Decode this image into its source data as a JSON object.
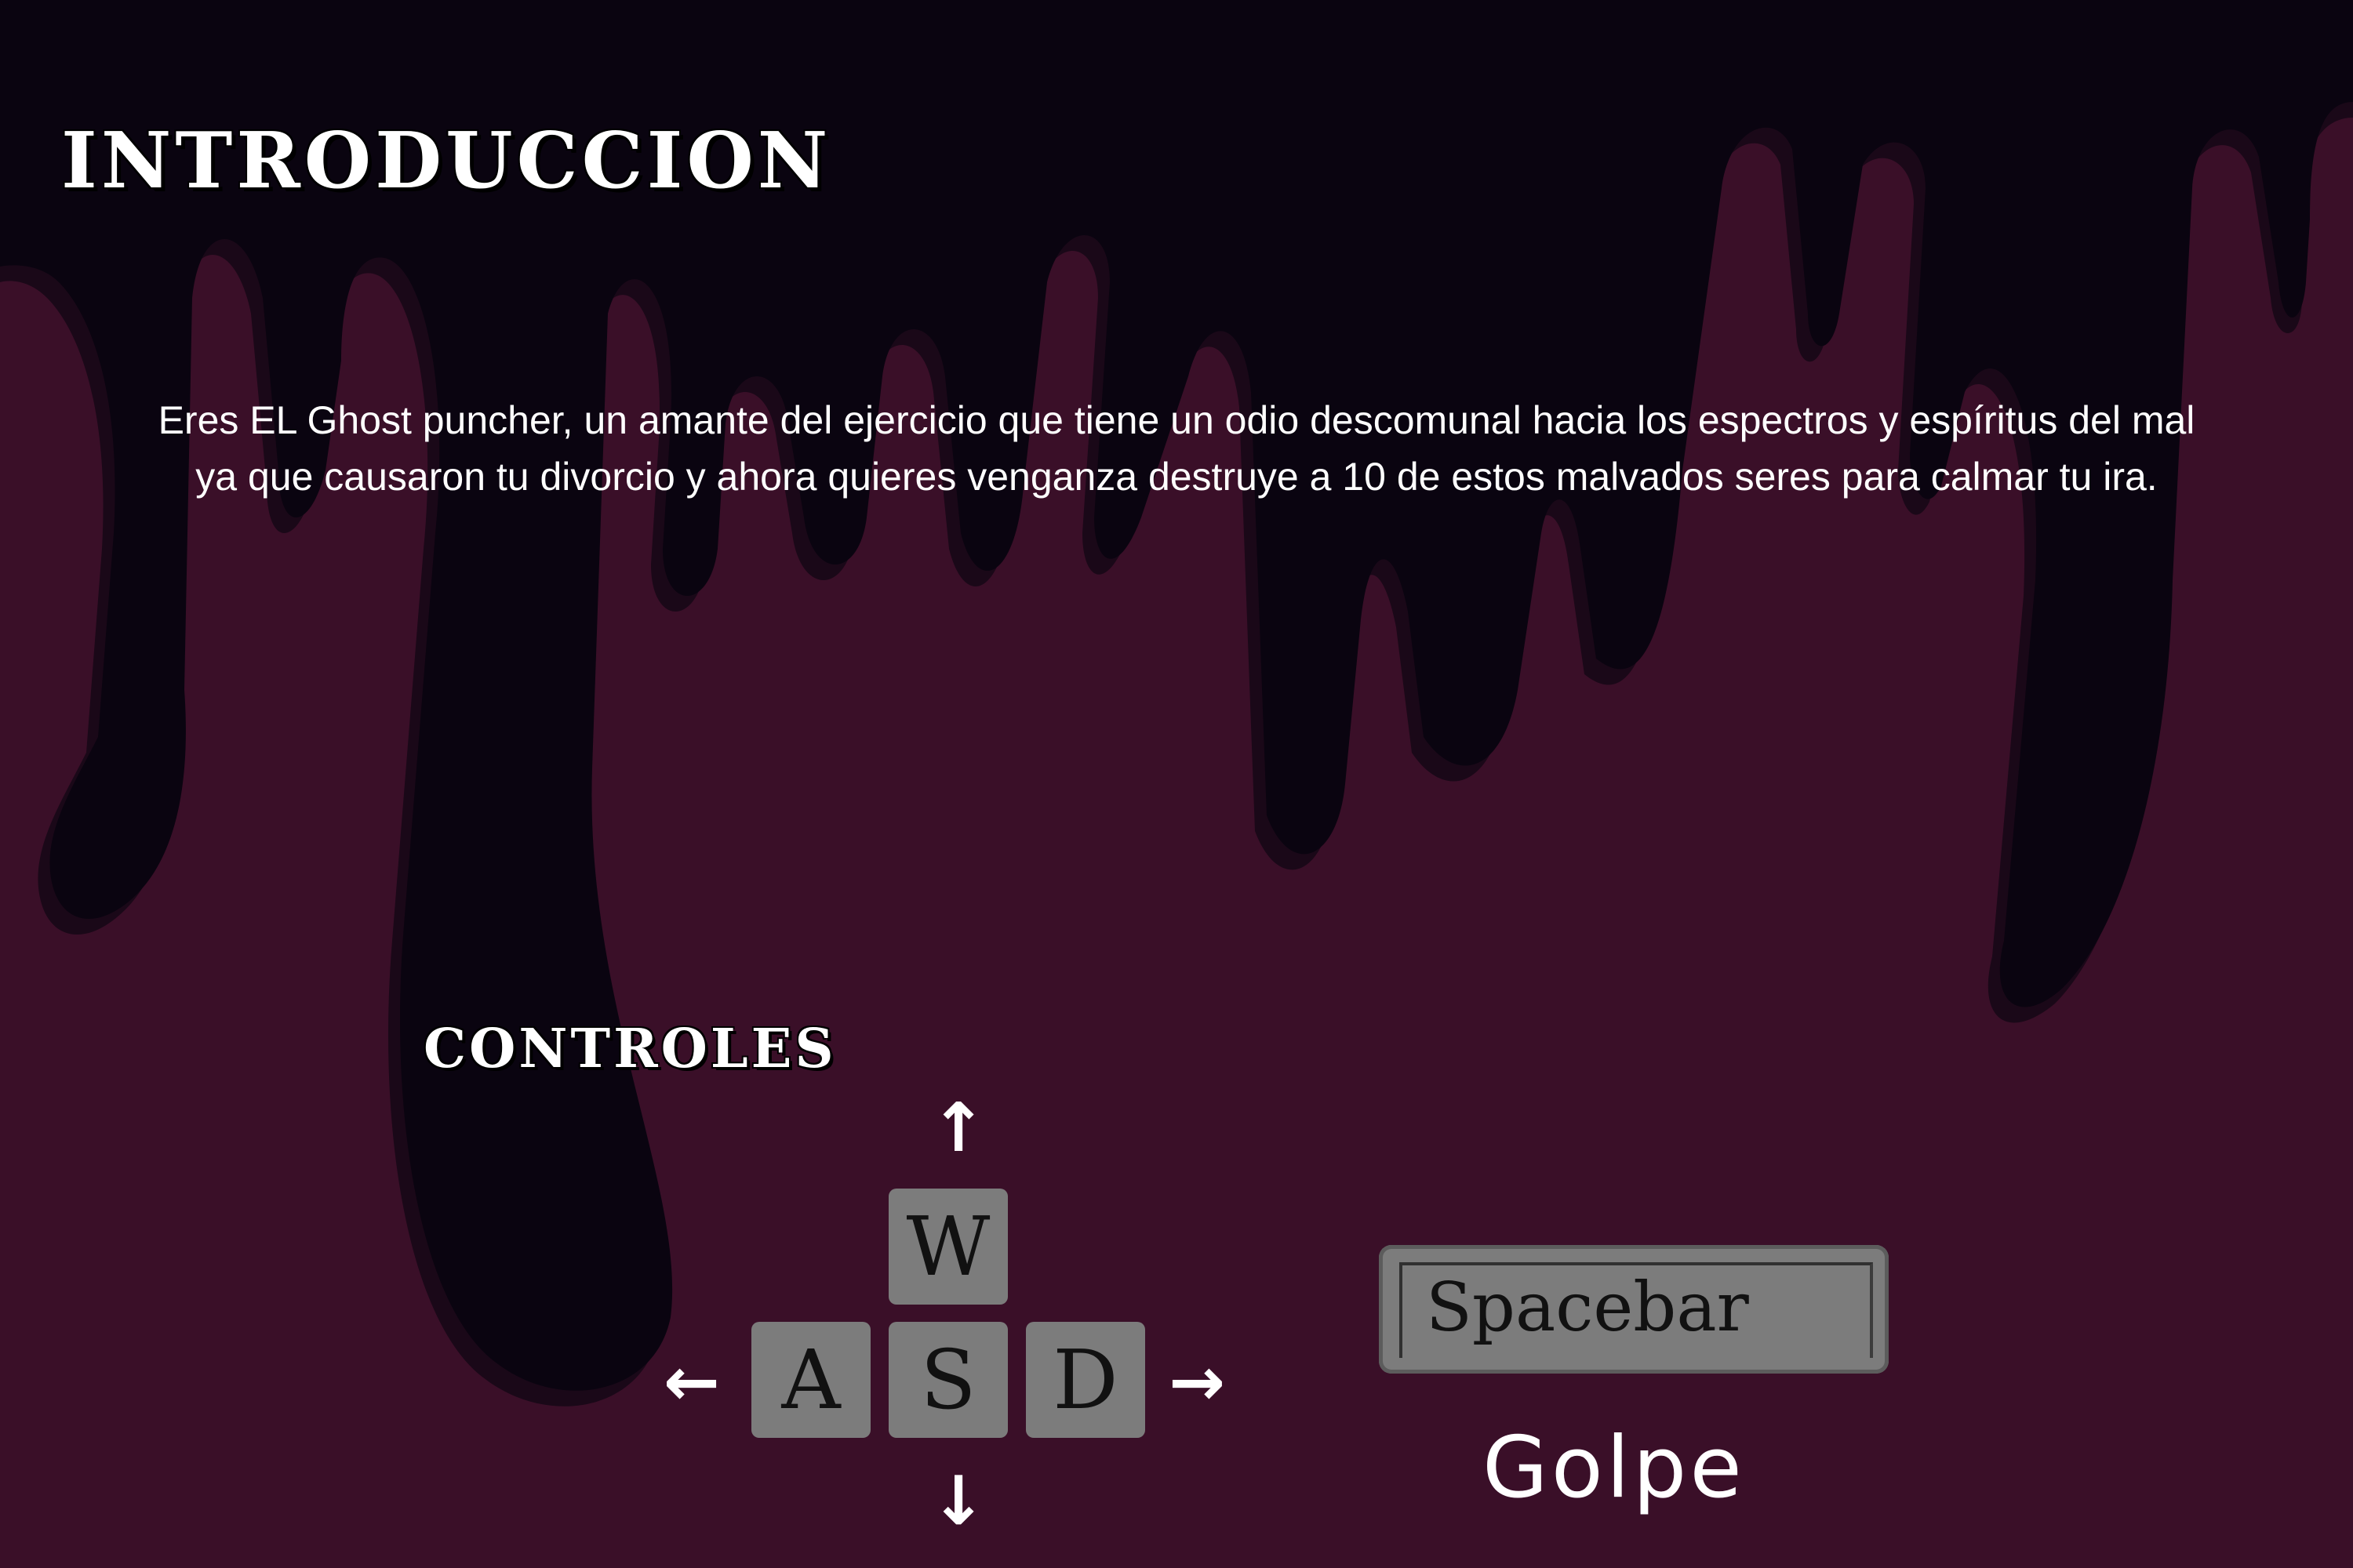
{
  "screen": {
    "title": "INTRODUCCION",
    "intro_lines": [
      "Eres EL Ghost puncher, un amante del ejercicio que tiene un odio descomunal hacia los espectros y espíritus del mal",
      "ya que causaron tu divorcio y ahora quieres venganza destruye a 10 de estos malvados seres para calmar tu ira."
    ]
  },
  "controls": {
    "title": "CONTROLES",
    "keys": {
      "up": "W",
      "left": "A",
      "down": "S",
      "right": "D"
    },
    "arrows": {
      "up": "↑",
      "left": "←",
      "down": "↓",
      "right": "→"
    },
    "action_key": "Spacebar",
    "action_label": "Golpe"
  },
  "colors": {
    "background": "#3a0f28",
    "drip": "#0a0410",
    "drip_shadow": "#1a0818",
    "key": "#7c7c7c",
    "text": "#ffffff"
  }
}
